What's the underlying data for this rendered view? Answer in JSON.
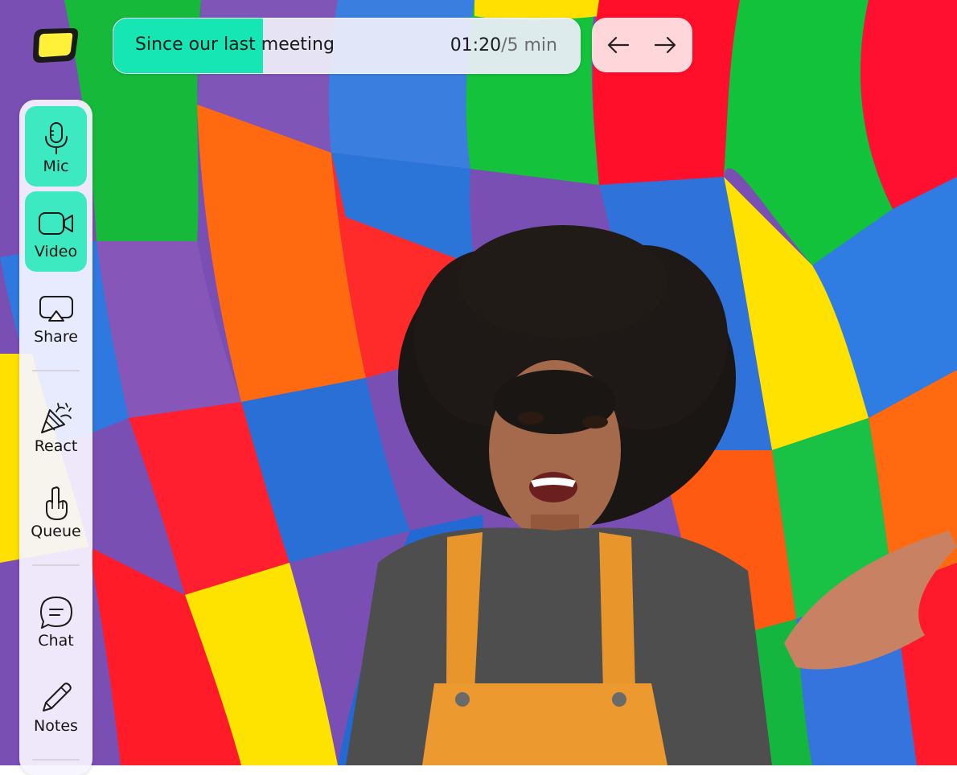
{
  "app": {
    "logo_icon": "yellow-hexagon-logo",
    "brand_color": "#fff03a"
  },
  "agenda": {
    "title": "Since our last meeting",
    "elapsed": "01:20",
    "separator": "/",
    "duration": "5 min",
    "progress": 0.32,
    "progress_color": "#16e5b4"
  },
  "navigation": {
    "prev_icon": "arrow-left-icon",
    "next_icon": "arrow-right-icon"
  },
  "toolbar": {
    "items": [
      {
        "label": "Mic",
        "icon": "microphone-icon",
        "active": true
      },
      {
        "label": "Video",
        "icon": "video-camera-icon",
        "active": true
      },
      {
        "label": "Share",
        "icon": "screen-share-icon",
        "active": false
      },
      {
        "label": "React",
        "icon": "party-popper-icon",
        "active": false
      },
      {
        "label": "Queue",
        "icon": "raised-hand-icon",
        "active": false
      },
      {
        "label": "Chat",
        "icon": "chat-bubble-icon",
        "active": false
      },
      {
        "label": "Notes",
        "icon": "pencil-icon",
        "active": false
      }
    ],
    "active_color": "#3ce9c1"
  }
}
